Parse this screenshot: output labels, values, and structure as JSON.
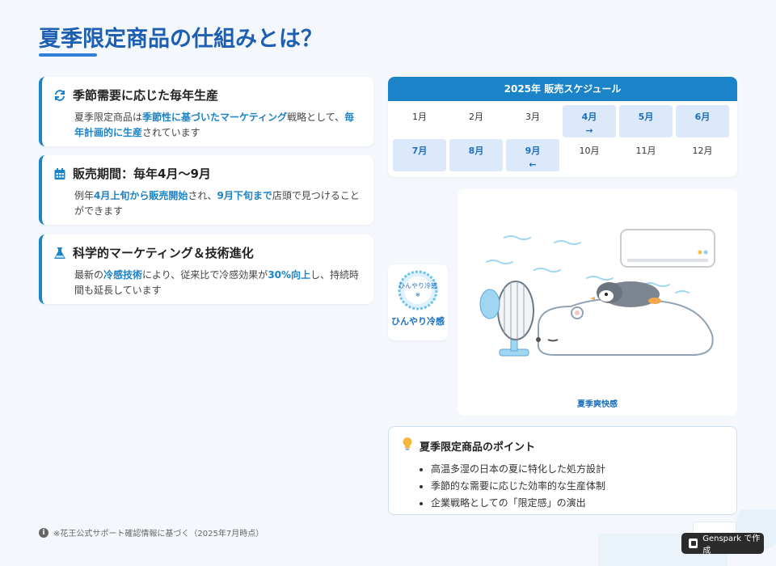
{
  "page": {
    "title": "夏季限定商品の仕組みとは？"
  },
  "cards": [
    {
      "icon": "sync-icon",
      "title": "季節需要に応じた毎年生産",
      "body": [
        {
          "t": "夏季限定商品は",
          "h": false
        },
        {
          "t": "季節性に基づいたマーケティング",
          "h": true
        },
        {
          "t": "戦略として、",
          "h": false
        },
        {
          "t": "毎年計画的に生産",
          "h": true
        },
        {
          "t": "されています",
          "h": false
        }
      ]
    },
    {
      "icon": "calendar-icon",
      "title": "販売期間：毎年4月〜9月",
      "body": [
        {
          "t": "例年",
          "h": false
        },
        {
          "t": "4月上旬から販売開始",
          "h": true
        },
        {
          "t": "され、",
          "h": false
        },
        {
          "t": "9月下旬まで",
          "h": true
        },
        {
          "t": "店頭で見つけることができます",
          "h": false
        }
      ]
    },
    {
      "icon": "flask-icon",
      "title": "科学的マーケティング＆技術進化",
      "body": [
        {
          "t": "最新の",
          "h": false
        },
        {
          "t": "冷感技術",
          "h": true
        },
        {
          "t": "により、従来比で冷感効果が",
          "h": false
        },
        {
          "t": "30%向上",
          "h": true
        },
        {
          "t": "し、持続時間も延長しています",
          "h": false
        }
      ]
    }
  ],
  "schedule": {
    "title": "2025年 販売スケジュール",
    "months": [
      {
        "label": "1月",
        "active": false,
        "arrow": ""
      },
      {
        "label": "2月",
        "active": false,
        "arrow": ""
      },
      {
        "label": "3月",
        "active": false,
        "arrow": ""
      },
      {
        "label": "4月",
        "active": true,
        "arrow": "→"
      },
      {
        "label": "5月",
        "active": true,
        "arrow": ""
      },
      {
        "label": "6月",
        "active": true,
        "arrow": ""
      },
      {
        "label": "7月",
        "active": true,
        "arrow": ""
      },
      {
        "label": "8月",
        "active": true,
        "arrow": ""
      },
      {
        "label": "9月",
        "active": true,
        "arrow": "←"
      },
      {
        "label": "10月",
        "active": false,
        "arrow": ""
      },
      {
        "label": "11月",
        "active": false,
        "arrow": ""
      },
      {
        "label": "12月",
        "active": false,
        "arrow": ""
      }
    ]
  },
  "badge": {
    "logo_text": "ひんやり冷感",
    "label": "ひんやり冷感"
  },
  "illustration": {
    "caption": "夏季爽快感"
  },
  "points": {
    "title": "夏季限定商品のポイント",
    "items": [
      "高温多湿の日本の夏に特化した処方設計",
      "季節的な需要に応じた効率的な生産体制",
      "企業戦略としての「限定感」の演出"
    ]
  },
  "footnote": "※花王公式サポート確認情報に基づく（2025年7月時点）",
  "genspark_badge": "Genspark で作成",
  "colors": {
    "accent": "#1b83c8",
    "title": "#1d5fb3",
    "highlight_bg": "#dce9fb"
  }
}
